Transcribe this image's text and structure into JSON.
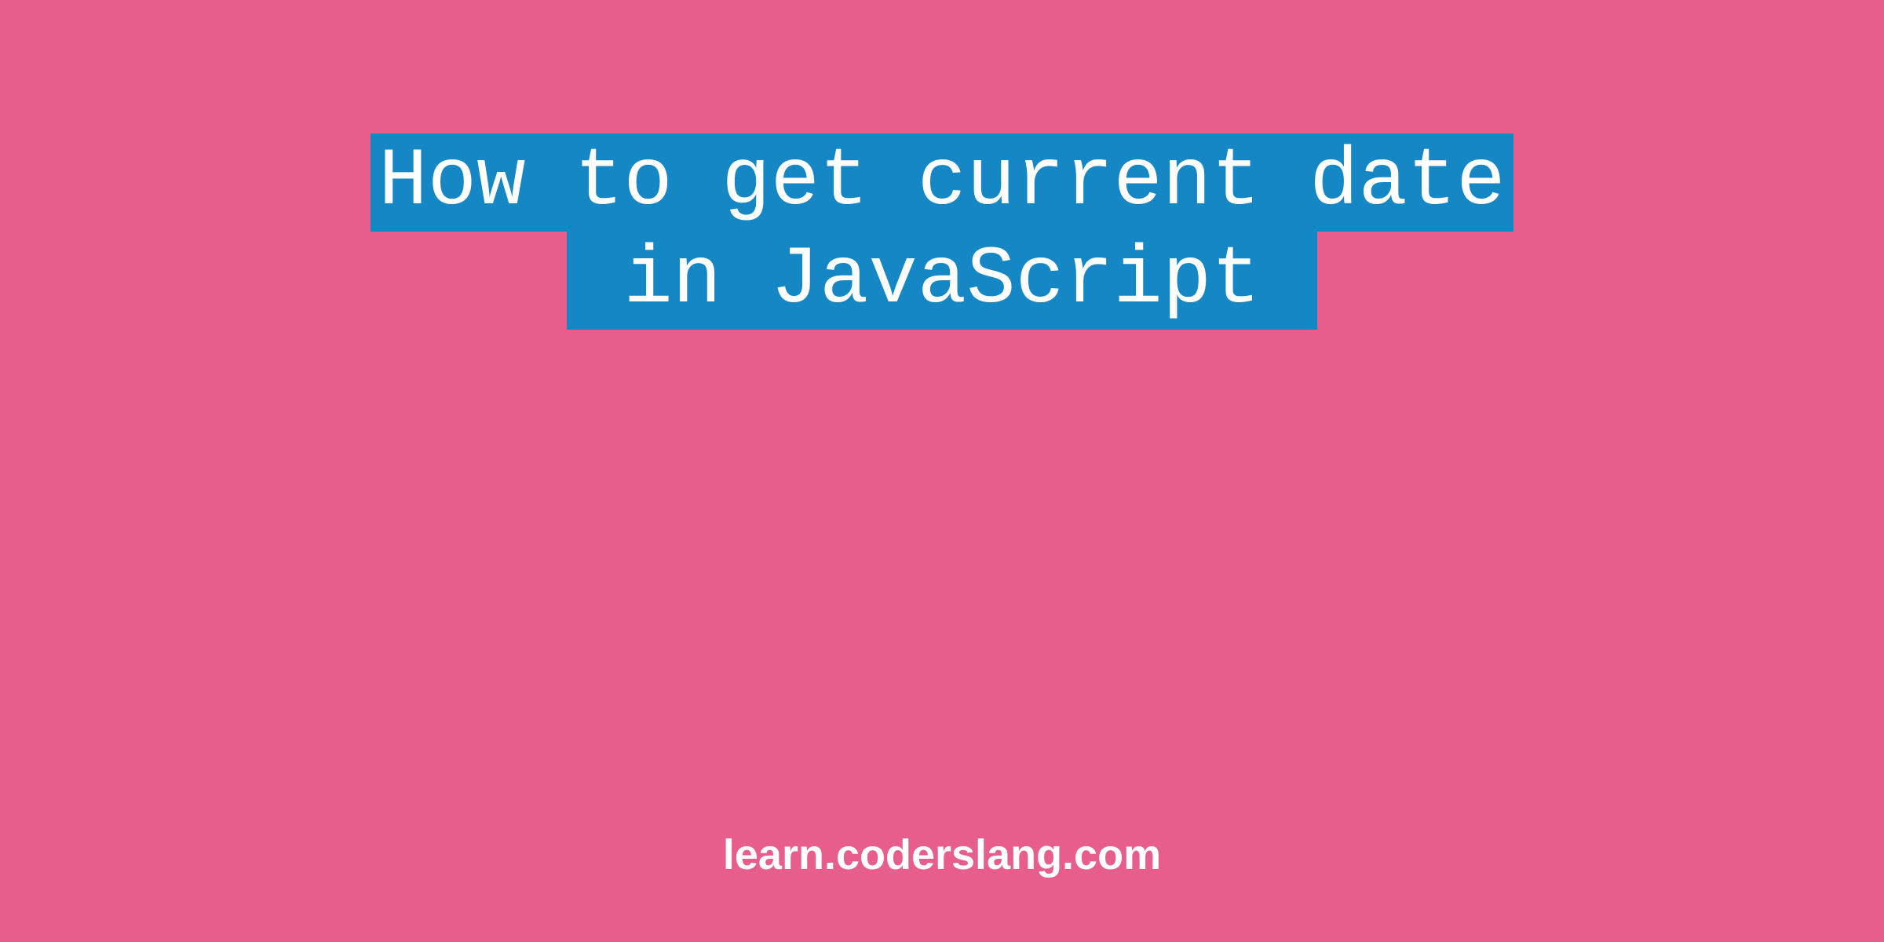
{
  "title": {
    "line1": "How to get current date",
    "line2": " in JavaScript "
  },
  "footer": {
    "text": "learn.coderslang.com"
  },
  "colors": {
    "background": "#e75e8d",
    "highlight": "#1587c4",
    "text": "#ffffff"
  }
}
